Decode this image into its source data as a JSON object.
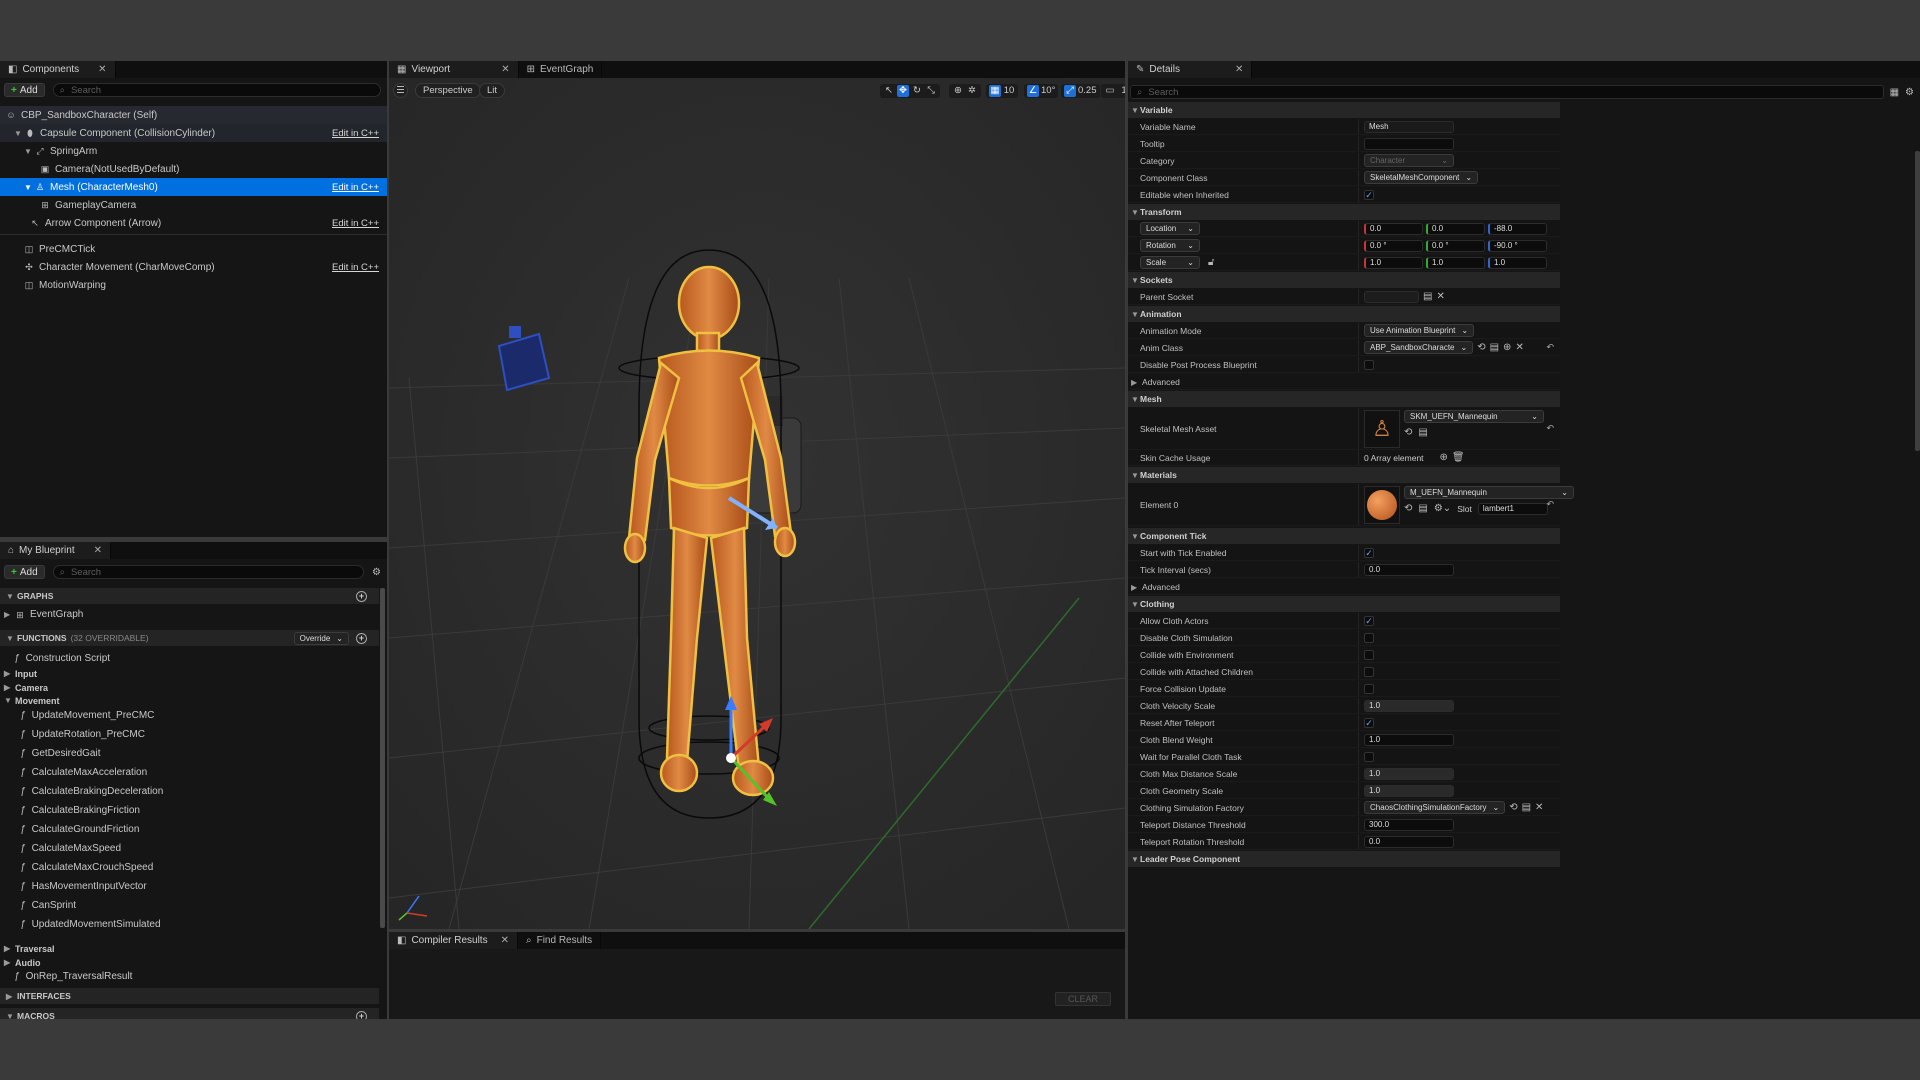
{
  "components_panel": {
    "tab_label": "Components",
    "add_label": "Add",
    "search_placeholder": "Search",
    "items": [
      {
        "label": "CBP_SandboxCharacter (Self)",
        "edit": ""
      },
      {
        "label": "Capsule Component (CollisionCylinder)",
        "edit": "Edit in C++"
      },
      {
        "label": "SpringArm",
        "edit": ""
      },
      {
        "label": "Camera(NotUsedByDefault)",
        "edit": ""
      },
      {
        "label": "Mesh (CharacterMesh0)",
        "edit": "Edit in C++"
      },
      {
        "label": "GameplayCamera",
        "edit": ""
      },
      {
        "label": "Arrow Component (Arrow)",
        "edit": "Edit in C++"
      },
      {
        "label": "PreCMCTick",
        "edit": ""
      },
      {
        "label": "Character Movement (CharMoveComp)",
        "edit": "Edit in C++"
      },
      {
        "label": "MotionWarping",
        "edit": ""
      }
    ]
  },
  "blueprint_panel": {
    "tab_label": "My Blueprint",
    "add_label": "Add",
    "search_placeholder": "Search",
    "graphs_label": "GRAPHS",
    "eventgraph_label": "EventGraph",
    "functions_label": "FUNCTIONS",
    "functions_count": "(32 OVERRIDABLE)",
    "override_label": "Override",
    "construction_script": "Construction Script",
    "categories_top": [
      "Input",
      "Camera",
      "Movement"
    ],
    "movement_functions": [
      "UpdateMovement_PreCMC",
      "UpdateRotation_PreCMC",
      "GetDesiredGait",
      "CalculateMaxAcceleration",
      "CalculateBrakingDeceleration",
      "CalculateBrakingFriction",
      "CalculateGroundFriction",
      "CalculateMaxSpeed",
      "CalculateMaxCrouchSpeed",
      "HasMovementInputVector",
      "CanSprint",
      "UpdatedMovementSimulated"
    ],
    "categories_bottom": [
      "Traversal",
      "Audio"
    ],
    "onrep_function": "OnRep_TraversalResult",
    "interfaces_label": "INTERFACES",
    "macros_label": "MACROS"
  },
  "viewport": {
    "tab_label": "Viewport",
    "tab2_label": "EventGraph",
    "perspective_label": "Perspective",
    "lit_label": "Lit",
    "grid_value": "10",
    "angle_value": "10°",
    "scale_value": "0.25",
    "camera_speed": "1"
  },
  "compiler": {
    "tab_label": "Compiler Results",
    "find_label": "Find Results",
    "clear_label": "CLEAR"
  },
  "details": {
    "tab_label": "Details",
    "search_placeholder": "Search",
    "variable": {
      "header": "Variable",
      "name_label": "Variable Name",
      "name_value": "Mesh",
      "tooltip_label": "Tooltip",
      "category_label": "Category",
      "category_value": "Character",
      "class_label": "Component Class",
      "class_value": "SkeletalMeshComponent",
      "editable_label": "Editable when Inherited"
    },
    "transform": {
      "header": "Transform",
      "location_label": "Location",
      "location": [
        "0.0",
        "0.0",
        "-88.0"
      ],
      "rotation_label": "Rotation",
      "rotation": [
        "0.0 °",
        "0.0 °",
        "-90.0 °"
      ],
      "scale_label": "Scale",
      "scale": [
        "1.0",
        "1.0",
        "1.0"
      ]
    },
    "sockets": {
      "header": "Sockets",
      "parent_label": "Parent Socket"
    },
    "animation": {
      "header": "Animation",
      "mode_label": "Animation Mode",
      "mode_value": "Use Animation Blueprint",
      "class_label": "Anim Class",
      "class_value": "ABP_SandboxCharacte",
      "disable_label": "Disable Post Process Blueprint",
      "advanced_label": "Advanced"
    },
    "mesh": {
      "header": "Mesh",
      "asset_label": "Skeletal Mesh Asset",
      "asset_value": "SKM_UEFN_Mannequin",
      "skin_label": "Skin Cache Usage",
      "skin_value": "0 Array element"
    },
    "materials": {
      "header": "Materials",
      "element_label": "Element 0",
      "element_value": "M_UEFN_Mannequin",
      "slot_label": "Slot",
      "slot_value": "lambert1"
    },
    "tick": {
      "header": "Component Tick",
      "start_label": "Start with Tick Enabled",
      "interval_label": "Tick Interval (secs)",
      "interval_value": "0.0",
      "advanced_label": "Advanced"
    },
    "clothing": {
      "header": "Clothing",
      "rows": [
        {
          "label": "Allow Cloth Actors",
          "type": "check",
          "checked": true
        },
        {
          "label": "Disable Cloth Simulation",
          "type": "check",
          "checked": false
        },
        {
          "label": "Collide with Environment",
          "type": "check",
          "checked": false
        },
        {
          "label": "Collide with Attached Children",
          "type": "check",
          "checked": false
        },
        {
          "label": "Force Collision Update",
          "type": "check",
          "checked": false
        },
        {
          "label": "Cloth Velocity Scale",
          "type": "slider",
          "value": "1.0"
        },
        {
          "label": "Reset After Teleport",
          "type": "check",
          "checked": true
        },
        {
          "label": "Cloth Blend Weight",
          "type": "input",
          "value": "1.0"
        },
        {
          "label": "Wait for Parallel Cloth Task",
          "type": "check",
          "checked": false
        },
        {
          "label": "Cloth Max Distance Scale",
          "type": "slider",
          "value": "1.0"
        },
        {
          "label": "Cloth Geometry Scale",
          "type": "slider",
          "value": "1.0"
        },
        {
          "label": "Clothing Simulation Factory",
          "type": "dropdown",
          "value": "ChaosClothingSimulationFactory"
        },
        {
          "label": "Teleport Distance Threshold",
          "type": "input",
          "value": "300.0"
        },
        {
          "label": "Teleport Rotation Threshold",
          "type": "input",
          "value": "0.0"
        }
      ]
    },
    "leader_header": "Leader Pose Component"
  }
}
